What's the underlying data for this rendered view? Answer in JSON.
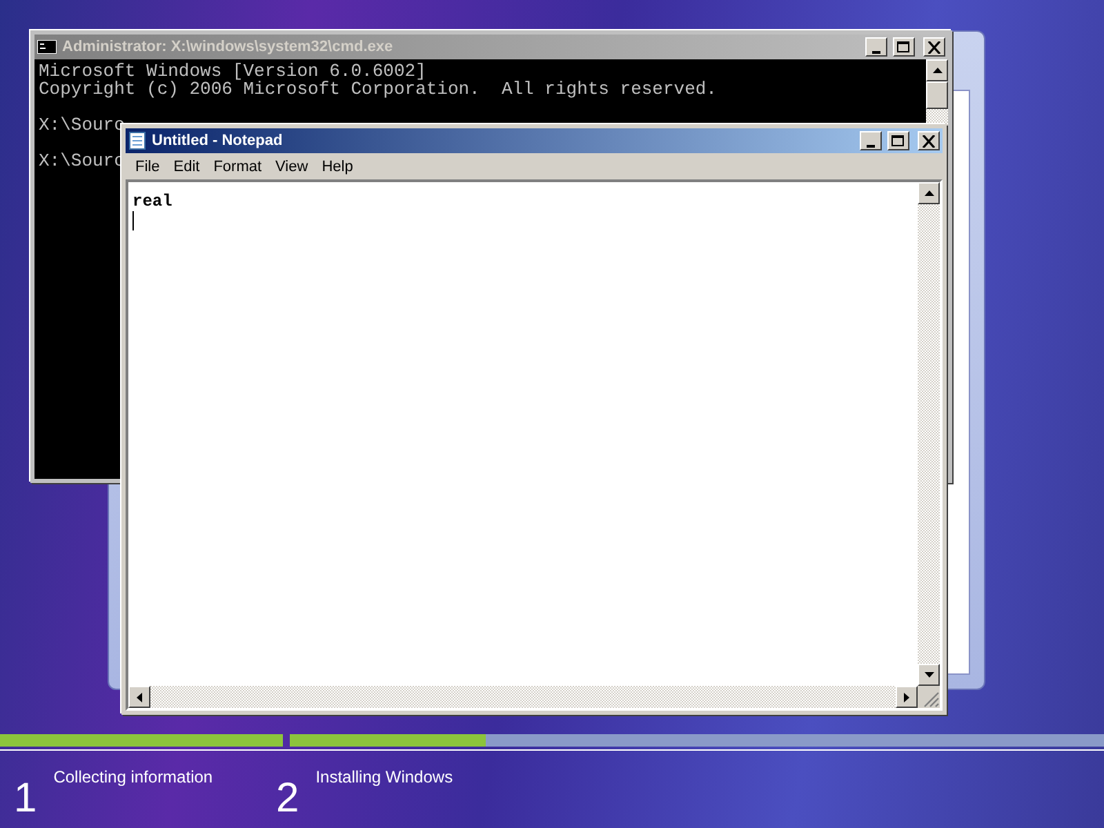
{
  "console_window": {
    "title": "Administrator: X:\\windows\\system32\\cmd.exe",
    "active": false,
    "lines": [
      {
        "kind": "output",
        "text": "Microsoft Windows [Version 6.0.6002]"
      },
      {
        "kind": "output",
        "text": "Copyright (c) 2006 Microsoft Corporation.  All rights reserved."
      },
      {
        "kind": "prompt",
        "text": "X:\\Sourc"
      },
      {
        "kind": "prompt",
        "text": "X:\\Sourc"
      }
    ]
  },
  "notepad_window": {
    "title": "Untitled - Notepad",
    "active": true,
    "menu": [
      "File",
      "Edit",
      "Format",
      "View",
      "Help"
    ],
    "text": "real"
  },
  "progress": [
    {
      "level": 1
    },
    {
      "level": 0.24
    }
  ],
  "steps": [
    {
      "number": "1",
      "label": "Collecting information"
    },
    {
      "number": "2",
      "label": "Installing Windows"
    }
  ]
}
